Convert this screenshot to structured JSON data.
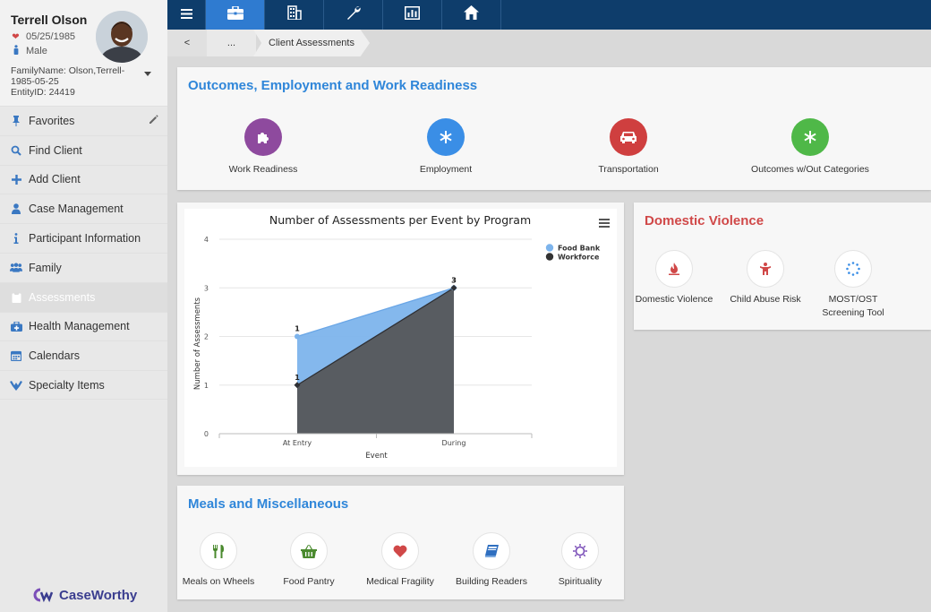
{
  "profile": {
    "name": "Terrell Olson",
    "dob": "05/25/1985",
    "gender": "Male",
    "family_name": "FamilyName: Olson,Terrell-1985-05-25",
    "entity_id": "EntityID: 24419"
  },
  "nav": [
    {
      "label": "Favorites",
      "icon": "pin-icon"
    },
    {
      "label": "Find Client",
      "icon": "search-icon"
    },
    {
      "label": "Add Client",
      "icon": "plus-icon"
    },
    {
      "label": "Case Management",
      "icon": "person-icon"
    },
    {
      "label": "Participant Information",
      "icon": "info-icon"
    },
    {
      "label": "Family",
      "icon": "group-icon"
    },
    {
      "label": "Assessments",
      "icon": "clipboard-icon"
    },
    {
      "label": "Health Management",
      "icon": "medkit-icon"
    },
    {
      "label": "Calendars",
      "icon": "calendar-icon"
    },
    {
      "label": "Specialty Items",
      "icon": "hands-icon"
    }
  ],
  "logo": "CaseWorthy",
  "breadcrumb": {
    "back": "<",
    "ellipsis": "...",
    "current": "Client Assessments"
  },
  "outcomes": {
    "title": "Outcomes, Employment and Work Readiness",
    "tiles": [
      {
        "label": "Work Readiness",
        "color": "#8e4a9e"
      },
      {
        "label": "Employment",
        "color": "#3a8ee6"
      },
      {
        "label": "Transportation",
        "color": "#cf3f3f"
      },
      {
        "label": "Outcomes w/Out Categories",
        "color": "#4fb848"
      }
    ]
  },
  "domestic": {
    "title": "Domestic Violence",
    "tiles": [
      {
        "label": "Domestic Violence"
      },
      {
        "label": "Child Abuse Risk"
      },
      {
        "label": "MOST/OST Screening Tool"
      }
    ]
  },
  "meals": {
    "title": "Meals and Miscellaneous",
    "tiles": [
      {
        "label": "Meals on Wheels"
      },
      {
        "label": "Food Pantry"
      },
      {
        "label": "Medical Fragility"
      },
      {
        "label": "Building Readers"
      },
      {
        "label": "Spirituality"
      }
    ]
  },
  "chart_data": {
    "type": "area",
    "title": "Number of Assessments per Event by Program",
    "xlabel": "Event",
    "ylabel": "Number of Assessments",
    "categories": [
      "At Entry",
      "During"
    ],
    "ylim": [
      0,
      4
    ],
    "yticks": [
      0,
      1,
      2,
      3,
      4
    ],
    "series": [
      {
        "name": "Food Bank",
        "values": [
          2,
          3
        ],
        "labels": [
          "1",
          "3"
        ],
        "color": "#7db4ec"
      },
      {
        "name": "Workforce",
        "values": [
          1,
          3
        ],
        "labels": [
          "1",
          "3"
        ],
        "color": "#55565a"
      }
    ],
    "stacked": false,
    "legend": "top-right",
    "grid": true
  }
}
